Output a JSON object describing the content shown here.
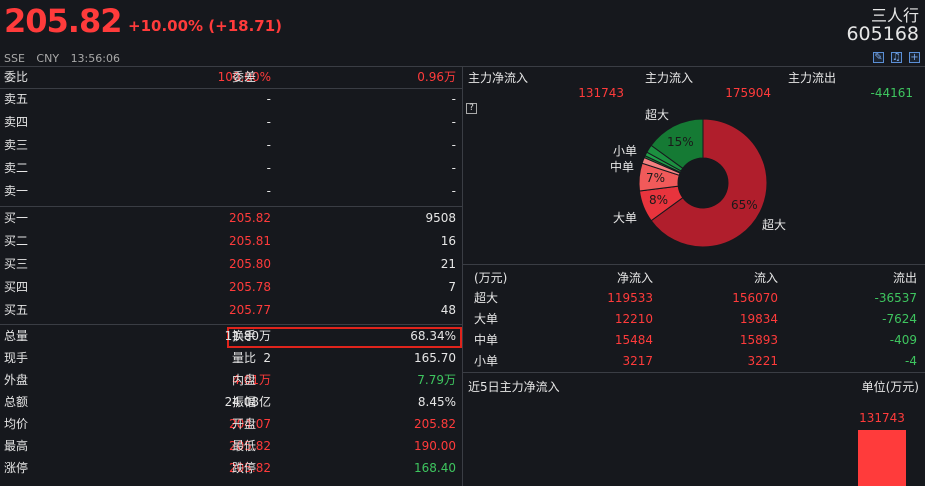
{
  "header": {
    "price": "205.82",
    "change": "+10.00% (+18.71)",
    "exchange": "SSE",
    "currency": "CNY",
    "time": "13:56:06",
    "stock_name": "三人行",
    "stock_code": "605168"
  },
  "colors": {
    "up": "#ff3b3b",
    "down": "#3ec55f",
    "highlight_border": "#e0241c"
  },
  "order_book": {
    "weibi_label": "委比",
    "weibi_value": "100.00%",
    "weicha_label": "委差",
    "weicha_value": "0.96万",
    "asks": [
      {
        "label": "卖五",
        "price": "-",
        "vol": "-"
      },
      {
        "label": "卖四",
        "price": "-",
        "vol": "-"
      },
      {
        "label": "卖三",
        "price": "-",
        "vol": "-"
      },
      {
        "label": "卖二",
        "price": "-",
        "vol": "-"
      },
      {
        "label": "卖一",
        "price": "-",
        "vol": "-"
      }
    ],
    "bids": [
      {
        "label": "买一",
        "price": "205.82",
        "vol": "9508"
      },
      {
        "label": "买二",
        "price": "205.81",
        "vol": "16"
      },
      {
        "label": "买三",
        "price": "205.80",
        "vol": "21"
      },
      {
        "label": "买四",
        "price": "205.78",
        "vol": "7"
      },
      {
        "label": "买五",
        "price": "205.77",
        "vol": "48"
      }
    ]
  },
  "stats": [
    {
      "l1": "总量",
      "v1": "11.80万",
      "c1": "white",
      "l2": "换手",
      "v2": "68.34%",
      "c2": "white"
    },
    {
      "l1": "现手",
      "v1": "2",
      "c1": "white",
      "l2": "量比",
      "v2": "165.70",
      "c2": "white"
    },
    {
      "l1": "外盘",
      "v1": "4.01万",
      "c1": "red",
      "l2": "内盘",
      "v2": "7.79万",
      "c2": "green"
    },
    {
      "l1": "总额",
      "v1": "24.08亿",
      "c1": "white",
      "l2": "振幅",
      "v2": "8.45%",
      "c2": "white"
    },
    {
      "l1": "均价",
      "v1": "204.07",
      "c1": "red",
      "l2": "开盘",
      "v2": "205.82",
      "c2": "red"
    },
    {
      "l1": "最高",
      "v1": "205.82",
      "c1": "red",
      "l2": "最低",
      "v2": "190.00",
      "c2": "red"
    },
    {
      "l1": "涨停",
      "v1": "205.82",
      "c1": "red",
      "l2": "跌停",
      "v2": "168.40",
      "c2": "green"
    }
  ],
  "flow": {
    "net_label": "主力净流入",
    "net_value": "131743",
    "in_label": "主力流入",
    "in_value": "175904",
    "out_label": "主力流出",
    "out_value": "-44161",
    "help_icon": "?"
  },
  "chart_data": [
    {
      "type": "pie",
      "slices": [
        {
          "label": "超大",
          "value": 65,
          "pct_text": "65%",
          "color": "#b01e2c",
          "side": "in"
        },
        {
          "label": "大单",
          "value": 8,
          "pct_text": "8%",
          "color": "#e8343d",
          "side": "in"
        },
        {
          "label": "中单",
          "value": 7,
          "pct_text": "7%",
          "color": "#f15a5a",
          "side": "in"
        },
        {
          "label": "小单",
          "value": 1.5,
          "pct_text": "",
          "color": "#f48080",
          "side": "in"
        },
        {
          "label": "",
          "value": 0.5,
          "pct_text": "",
          "color": "#1a8a3a",
          "side": "out"
        },
        {
          "label": "",
          "value": 1,
          "pct_text": "",
          "color": "#20a048",
          "side": "out"
        },
        {
          "label": "",
          "value": 2,
          "pct_text": "",
          "color": "#1c9040",
          "side": "out"
        },
        {
          "label": "超大",
          "value": 15,
          "pct_text": "15%",
          "color": "#157a34",
          "side": "out"
        }
      ]
    },
    {
      "type": "bar",
      "title": "近5日主力净流入",
      "unit_label": "单位(万元)",
      "categories": [
        ""
      ],
      "values": [
        131743
      ],
      "value_labels": [
        "131743"
      ]
    }
  ],
  "flow_table": {
    "headers": [
      "(万元)",
      "净流入",
      "流入",
      "流出"
    ],
    "rows": [
      {
        "label": "超大",
        "net": "119533",
        "in": "156070",
        "out": "-36537"
      },
      {
        "label": "大单",
        "net": "12210",
        "in": "19834",
        "out": "-7624"
      },
      {
        "label": "中单",
        "net": "15484",
        "in": "15893",
        "out": "-409"
      },
      {
        "label": "小单",
        "net": "3217",
        "in": "3221",
        "out": "-4"
      }
    ]
  },
  "icons": [
    "edit-icon",
    "bell-icon",
    "add-icon"
  ]
}
